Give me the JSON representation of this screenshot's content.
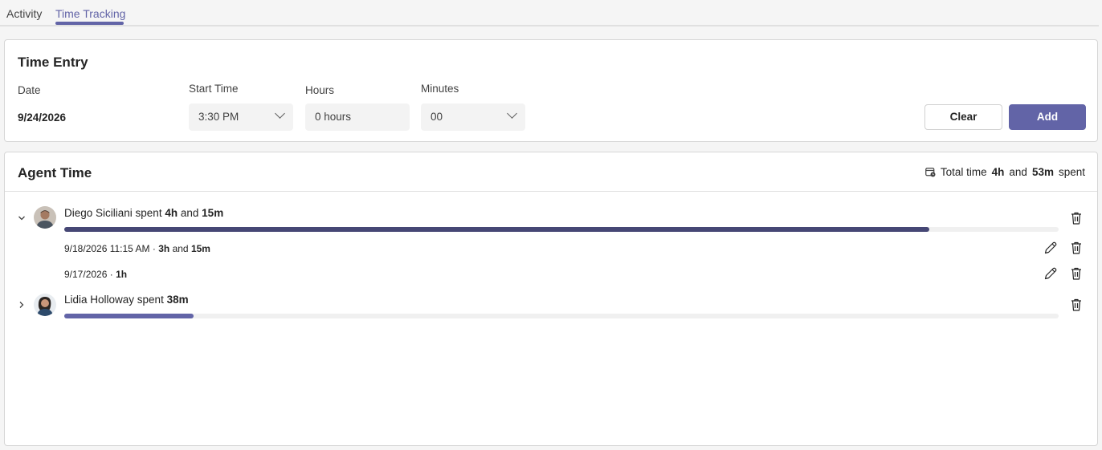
{
  "tabs": [
    {
      "label": "Activity",
      "active": false
    },
    {
      "label": "Time Tracking",
      "active": true
    }
  ],
  "time_entry": {
    "title": "Time Entry",
    "date_label": "Date",
    "date_value": "9/24/2026",
    "start_time_label": "Start Time",
    "start_time_value": "3:30 PM",
    "hours_label": "Hours",
    "hours_placeholder": "0 hours",
    "minutes_label": "Minutes",
    "minutes_value": "00",
    "clear_label": "Clear",
    "add_label": "Add"
  },
  "agent_time": {
    "title": "Agent Time",
    "total_prefix": "Total time",
    "total_hours": "4h",
    "total_and": "and",
    "total_minutes": "53m",
    "total_suffix": "spent",
    "agents": [
      {
        "name_spent": "Diego Siciliani spent",
        "hours": "4h",
        "and": "and",
        "minutes": "15m",
        "expanded": true,
        "progress": 0.87,
        "bar_color": "#464775",
        "entries": [
          {
            "datetime": "9/18/2026 11:15 AM",
            "sep": "·",
            "hours": "3h",
            "and": "and",
            "minutes": "15m"
          },
          {
            "datetime": "9/17/2026",
            "sep": "·",
            "hours": "1h"
          }
        ]
      },
      {
        "name_spent": "Lidia Holloway spent",
        "minutes": "38m",
        "expanded": false,
        "progress": 0.13,
        "bar_color": "#6264a7"
      }
    ]
  },
  "colors": {
    "accent": "#6264a7",
    "dark_bar": "#464775"
  }
}
